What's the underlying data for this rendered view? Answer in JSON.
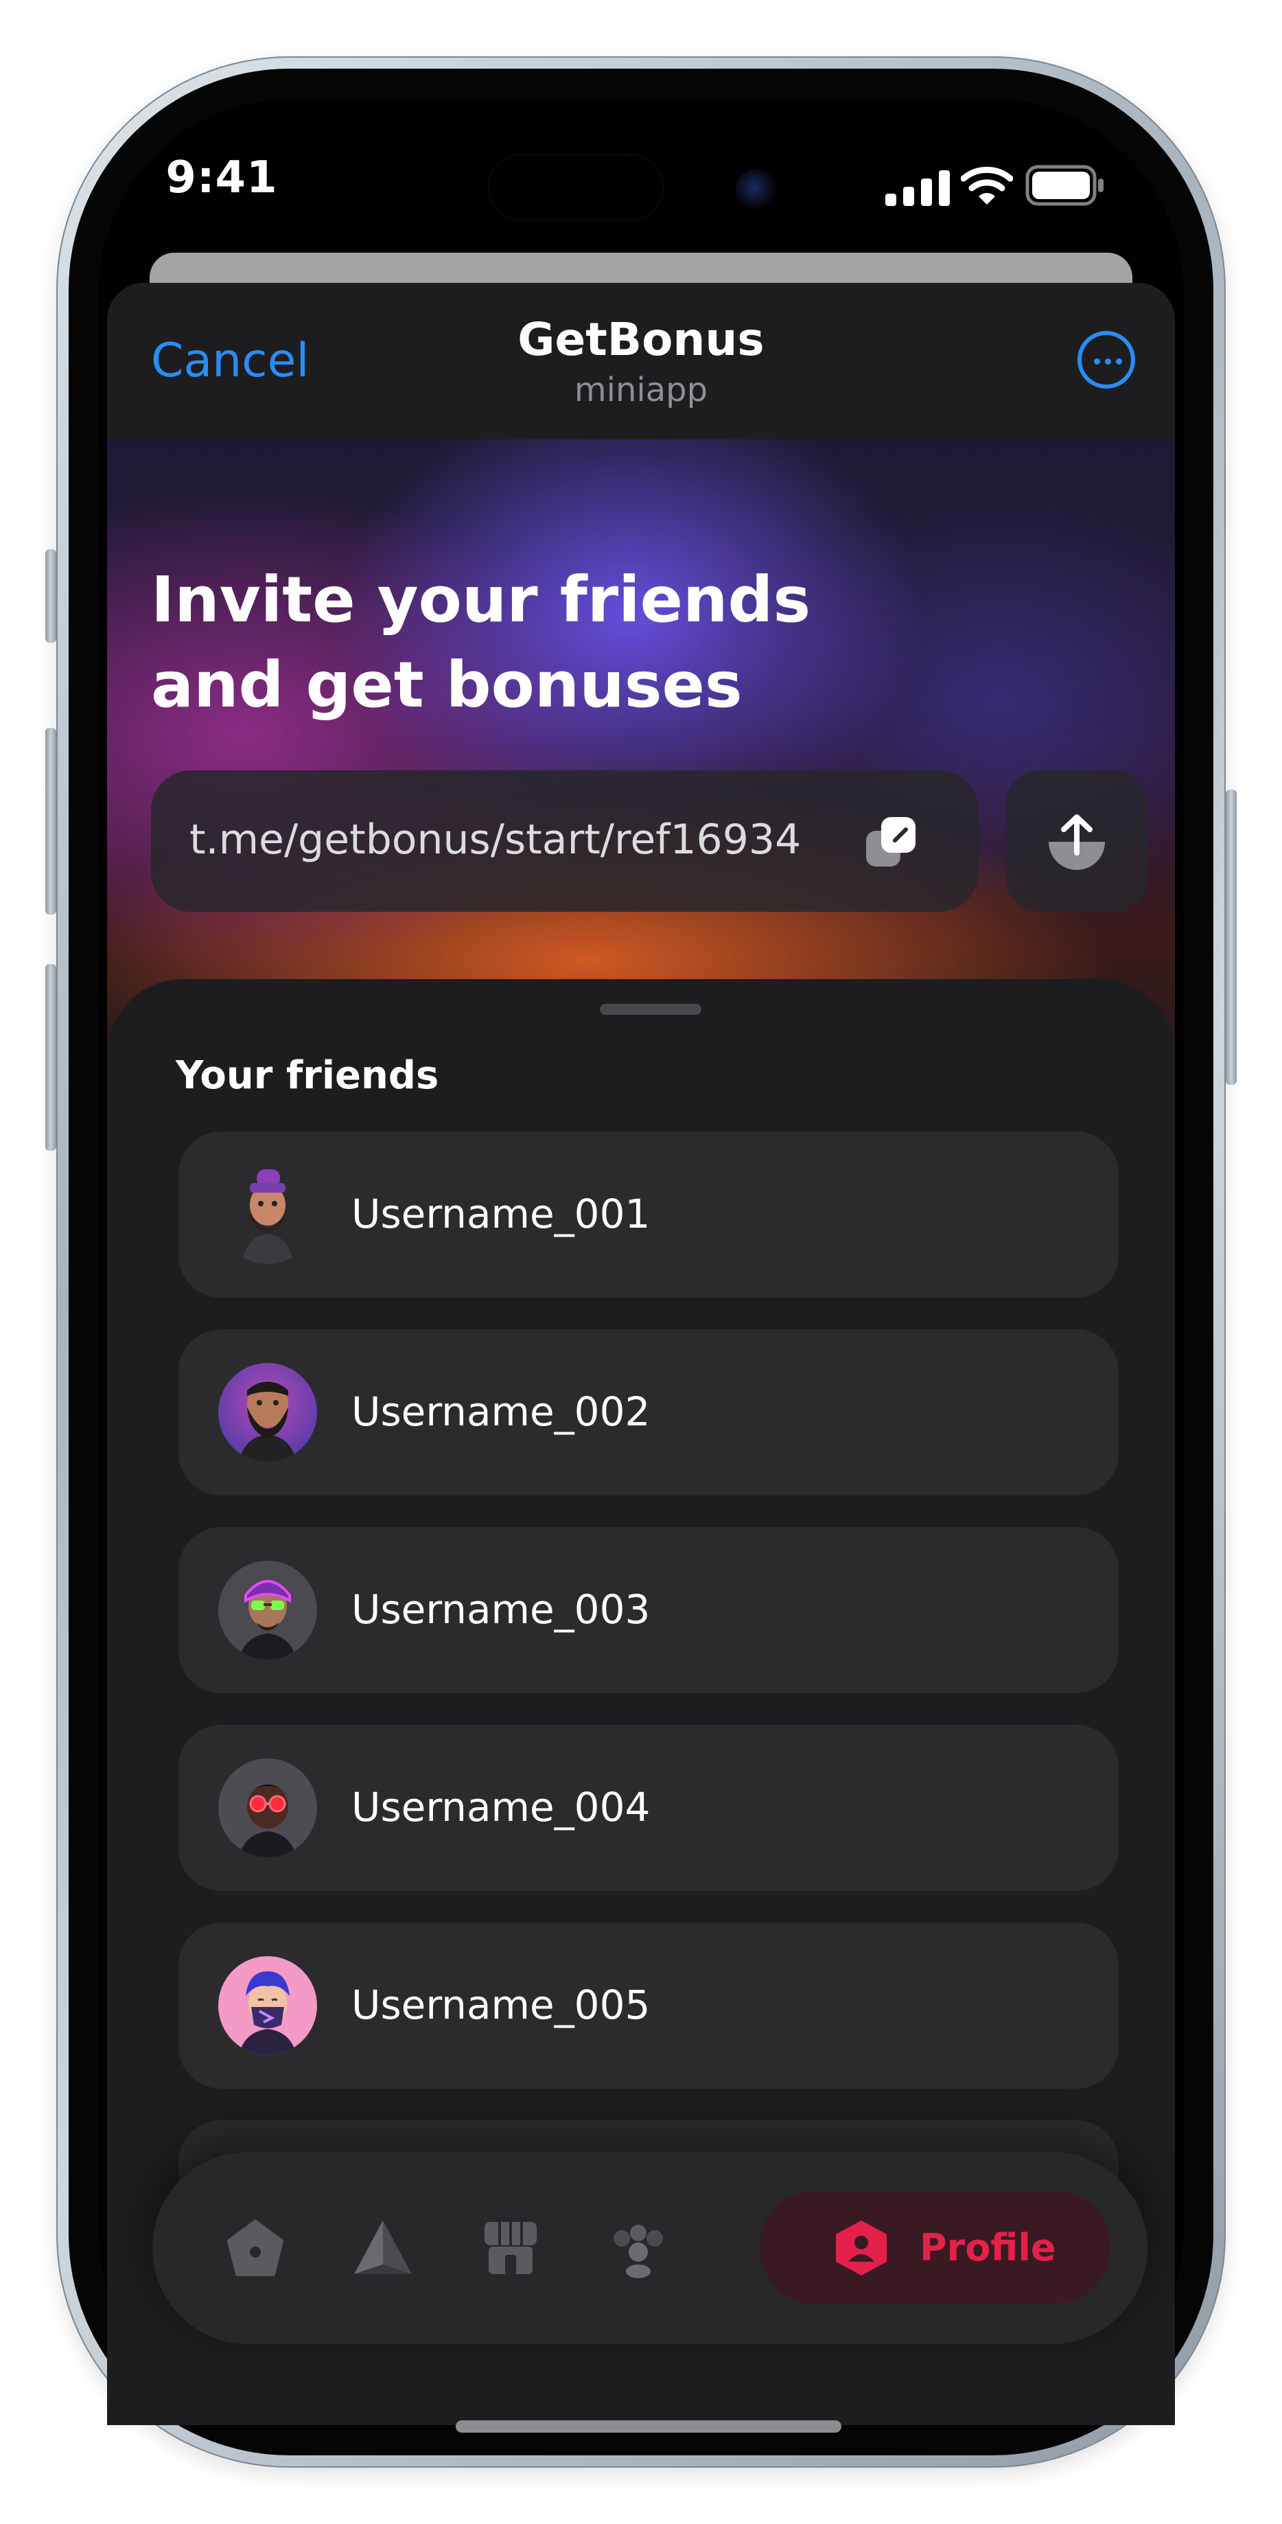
{
  "status_bar": {
    "time": "9:41"
  },
  "nav": {
    "cancel_label": "Cancel",
    "title": "GetBonus",
    "subtitle": "miniapp",
    "more_icon": "ellipsis-circle-icon"
  },
  "hero": {
    "title_line1": "Invite your friends",
    "title_line2": "and get bonuses",
    "referral_link": "t.me/getbonus/start/ref16934",
    "copy_icon": "copy-icon",
    "share_icon": "share-icon"
  },
  "friends": {
    "section_title": "Your friends",
    "items": [
      {
        "username": "Username_001"
      },
      {
        "username": "Username_002"
      },
      {
        "username": "Username_003"
      },
      {
        "username": "Username_004"
      },
      {
        "username": "Username_005"
      }
    ]
  },
  "tabbar": {
    "tabs": [
      {
        "icon": "home-icon",
        "active": false
      },
      {
        "icon": "pyramid-icon",
        "active": false
      },
      {
        "icon": "store-icon",
        "active": false
      },
      {
        "icon": "friends-icon",
        "active": false
      },
      {
        "icon": "profile-icon",
        "label": "Profile",
        "active": true
      }
    ]
  },
  "colors": {
    "accent_blue": "#2a8cf5",
    "active_tab_red": "#e3214b",
    "sheet_background": "#1d1d1f",
    "card_background": "#2b2b2e"
  }
}
